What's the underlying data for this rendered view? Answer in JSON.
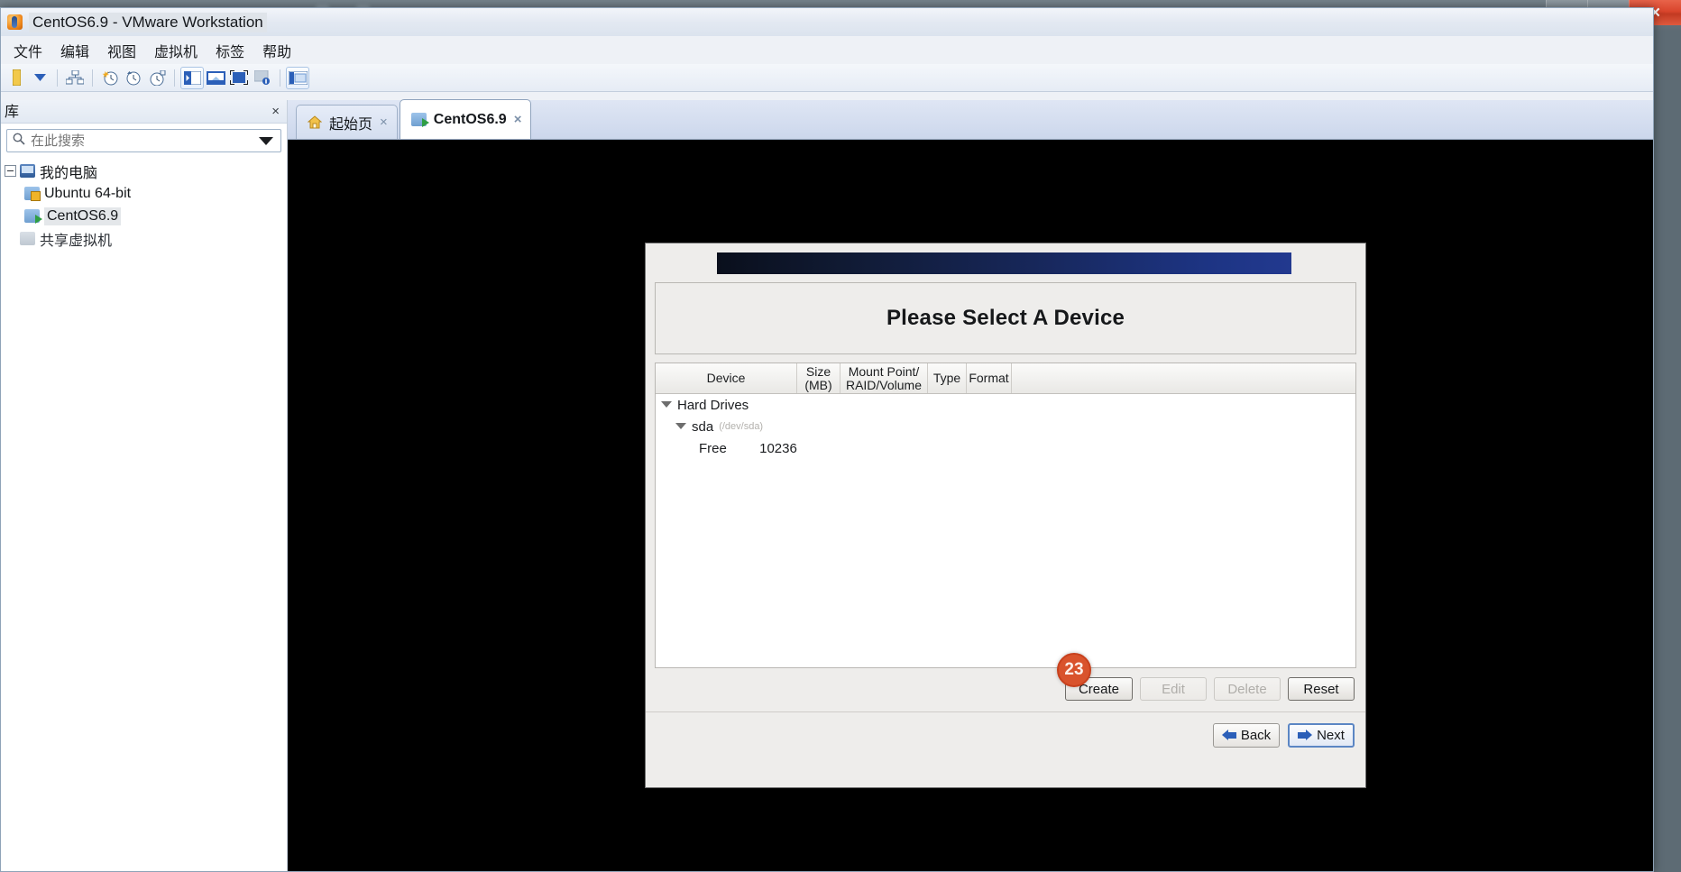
{
  "window": {
    "title": "CentOS6.9 - VMware Workstation",
    "app_icon": "vmware-icon",
    "controls": {
      "minimize": "minimize-button",
      "maximize": "maximize-button",
      "close": "×"
    },
    "background_window_text": "································"
  },
  "menubar": {
    "items": [
      {
        "label": "文件"
      },
      {
        "label": "编辑"
      },
      {
        "label": "视图"
      },
      {
        "label": "虚拟机"
      },
      {
        "label": "标签"
      },
      {
        "label": "帮助"
      }
    ]
  },
  "toolbar": {
    "buttons": [
      {
        "name": "power-dropdown-icon"
      },
      {
        "name": "snapshot-manager-icon"
      },
      {
        "name": "take-snapshot-icon"
      },
      {
        "name": "revert-snapshot-icon"
      },
      {
        "name": "manage-snapshots-icon"
      },
      {
        "name": "console-view-icon"
      },
      {
        "name": "fullscreen-stretch-icon"
      },
      {
        "name": "unity-mode-icon"
      },
      {
        "name": "vm-settings-icon"
      },
      {
        "name": "show-library-icon"
      }
    ]
  },
  "sidebar": {
    "header_label": "库",
    "close_label": "×",
    "search": {
      "placeholder": "在此搜索",
      "value": ""
    },
    "tree": [
      {
        "label": "我的电脑",
        "icon": "monitor-icon",
        "depth": 0,
        "expander": "minus",
        "selected": false
      },
      {
        "label": "Ubuntu 64-bit",
        "icon": "vm-paused-icon",
        "depth": 1,
        "expander": "none",
        "selected": false
      },
      {
        "label": "CentOS6.9",
        "icon": "vm-running-icon",
        "depth": 1,
        "expander": "none",
        "selected": true
      },
      {
        "label": "共享虚拟机",
        "icon": "shared-vm-icon",
        "depth": 0,
        "expander": "none",
        "selected": false
      }
    ]
  },
  "tabs": [
    {
      "label": "起始页",
      "icon": "home-icon",
      "active": false,
      "close": "×"
    },
    {
      "label": "CentOS6.9",
      "icon": "vm-running-icon",
      "active": true,
      "close": "×"
    }
  ],
  "dialog": {
    "title": "Please Select A Device",
    "table": {
      "columns": [
        {
          "label": "Device"
        },
        {
          "label": "Size\n(MB)",
          "line1": "Size",
          "line2": "(MB)"
        },
        {
          "label": "Mount Point/\nRAID/Volume",
          "line1": "Mount Point/",
          "line2": "RAID/Volume"
        },
        {
          "label": "Type"
        },
        {
          "label": "Format"
        }
      ],
      "rows": [
        {
          "device": "Hard Drives",
          "sub": "",
          "size": "",
          "mount": "",
          "type": "",
          "format": "",
          "depth": 0,
          "expander": "down"
        },
        {
          "device": "sda",
          "sub": "(/dev/sda)",
          "size": "",
          "mount": "",
          "type": "",
          "format": "",
          "depth": 1,
          "expander": "down"
        },
        {
          "device": "Free",
          "sub": "",
          "size": "10236",
          "mount": "",
          "type": "",
          "format": "",
          "depth": 2,
          "expander": "none"
        }
      ]
    },
    "action_buttons": [
      {
        "label": "Create",
        "enabled": true
      },
      {
        "label": "Edit",
        "enabled": false
      },
      {
        "label": "Delete",
        "enabled": false
      },
      {
        "label": "Reset",
        "enabled": true
      }
    ],
    "nav_buttons": [
      {
        "label": "Back",
        "icon": "arrow-left-icon",
        "focused": false
      },
      {
        "label": "Next",
        "icon": "arrow-right-icon",
        "focused": true
      }
    ]
  },
  "annotation": {
    "badge_number": "23",
    "color": "#d9532c"
  }
}
